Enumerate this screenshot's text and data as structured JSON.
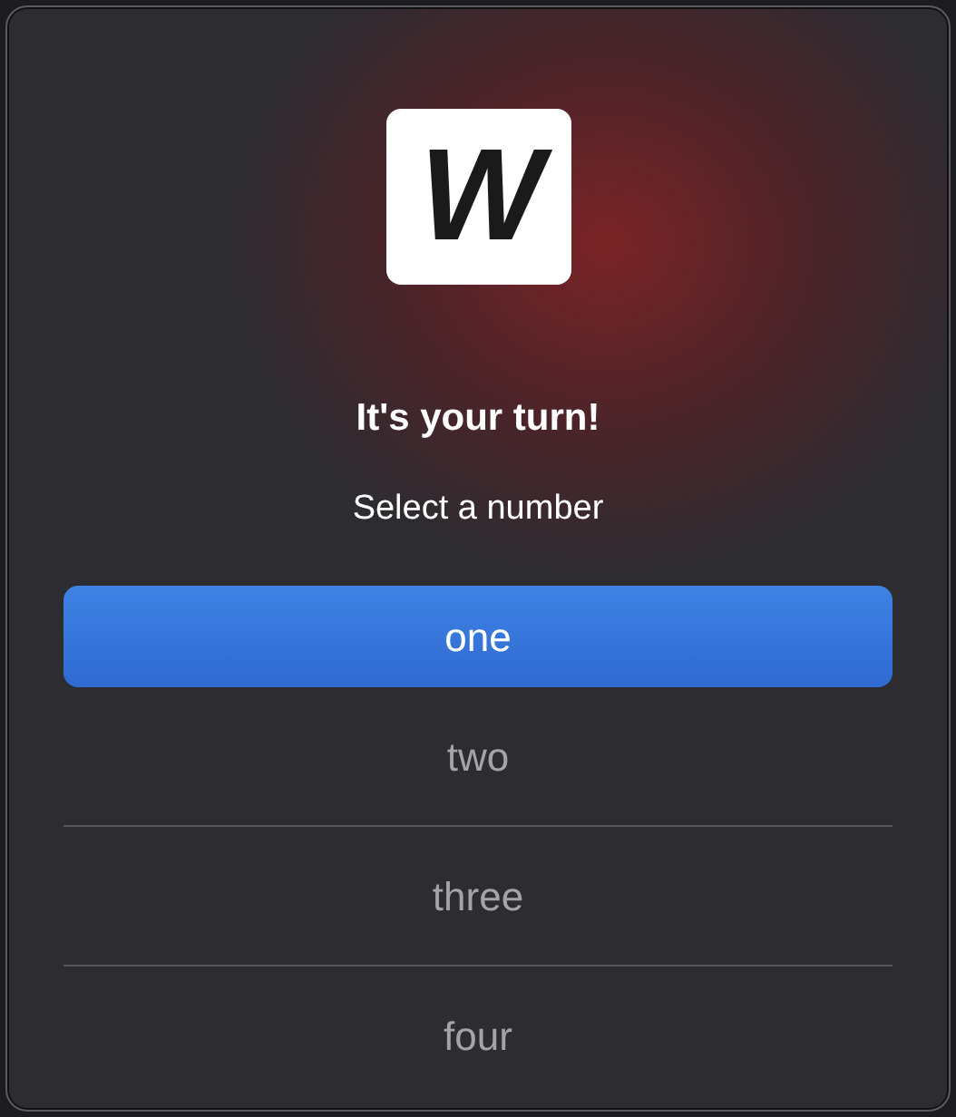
{
  "logo": {
    "text": "W"
  },
  "title": "It's your turn!",
  "message": "Select a number",
  "options": [
    {
      "label": "one",
      "selected": true
    },
    {
      "label": "two",
      "selected": false
    },
    {
      "label": "three",
      "selected": false
    },
    {
      "label": "four",
      "selected": false
    }
  ]
}
